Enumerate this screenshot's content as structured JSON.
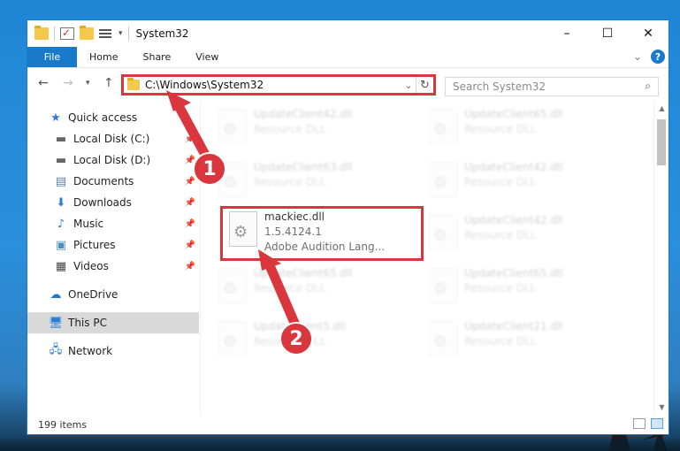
{
  "window": {
    "title": "System32",
    "caption": {
      "minimize": "–",
      "maximize": "☐",
      "close": "✕"
    }
  },
  "ribbon": {
    "tabs": [
      "File",
      "Home",
      "Share",
      "View"
    ]
  },
  "address": {
    "path": "C:\\Windows\\System32"
  },
  "search": {
    "placeholder": "Search System32"
  },
  "sidebar": {
    "items": [
      {
        "label": "Quick access",
        "icon": "star-icon",
        "pinned": false
      },
      {
        "label": "Local Disk (C:)",
        "icon": "drive-icon",
        "pinned": true
      },
      {
        "label": "Local Disk (D:)",
        "icon": "drive-icon",
        "pinned": true
      },
      {
        "label": "Documents",
        "icon": "documents-icon",
        "pinned": true
      },
      {
        "label": "Downloads",
        "icon": "download-icon",
        "pinned": true
      },
      {
        "label": "Music",
        "icon": "music-icon",
        "pinned": true
      },
      {
        "label": "Pictures",
        "icon": "pictures-icon",
        "pinned": true
      },
      {
        "label": "Videos",
        "icon": "videos-icon",
        "pinned": true
      },
      {
        "label": "OneDrive",
        "icon": "cloud-icon",
        "pinned": false
      },
      {
        "label": "This PC",
        "icon": "computer-icon",
        "pinned": false,
        "selected": true
      },
      {
        "label": "Network",
        "icon": "network-icon",
        "pinned": false
      }
    ]
  },
  "files": [
    {
      "name": "UpdateClient42.dll",
      "sub": "Resource DLL"
    },
    {
      "name": "UpdateClient65.dll",
      "sub": "Resource DLL"
    },
    {
      "name": "UpdateClient63.dll",
      "sub": "Resource DLL"
    },
    {
      "name": "UpdateClient42.dll",
      "sub": "Resource DLL"
    },
    {
      "name": "mackiec.dll",
      "version": "1.5.4124.1",
      "sub": "Adobe Audition Lang..."
    },
    {
      "name": "UpdateClient42.dll",
      "sub": "Resource DLL"
    },
    {
      "name": "UpdateClient65.dll",
      "sub": "Resource DLL"
    },
    {
      "name": "UpdateClient65.dll",
      "sub": "Resource DLL"
    },
    {
      "name": "UpdateClient5.dll",
      "sub": "Resource DLL"
    },
    {
      "name": "UpdateClient21.dll",
      "sub": "Resource DLL"
    }
  ],
  "status": {
    "item_count": "199 items"
  },
  "callouts": {
    "step1": "1",
    "step2": "2"
  },
  "colors": {
    "accent": "#1979ca",
    "highlight": "#d9363e"
  }
}
